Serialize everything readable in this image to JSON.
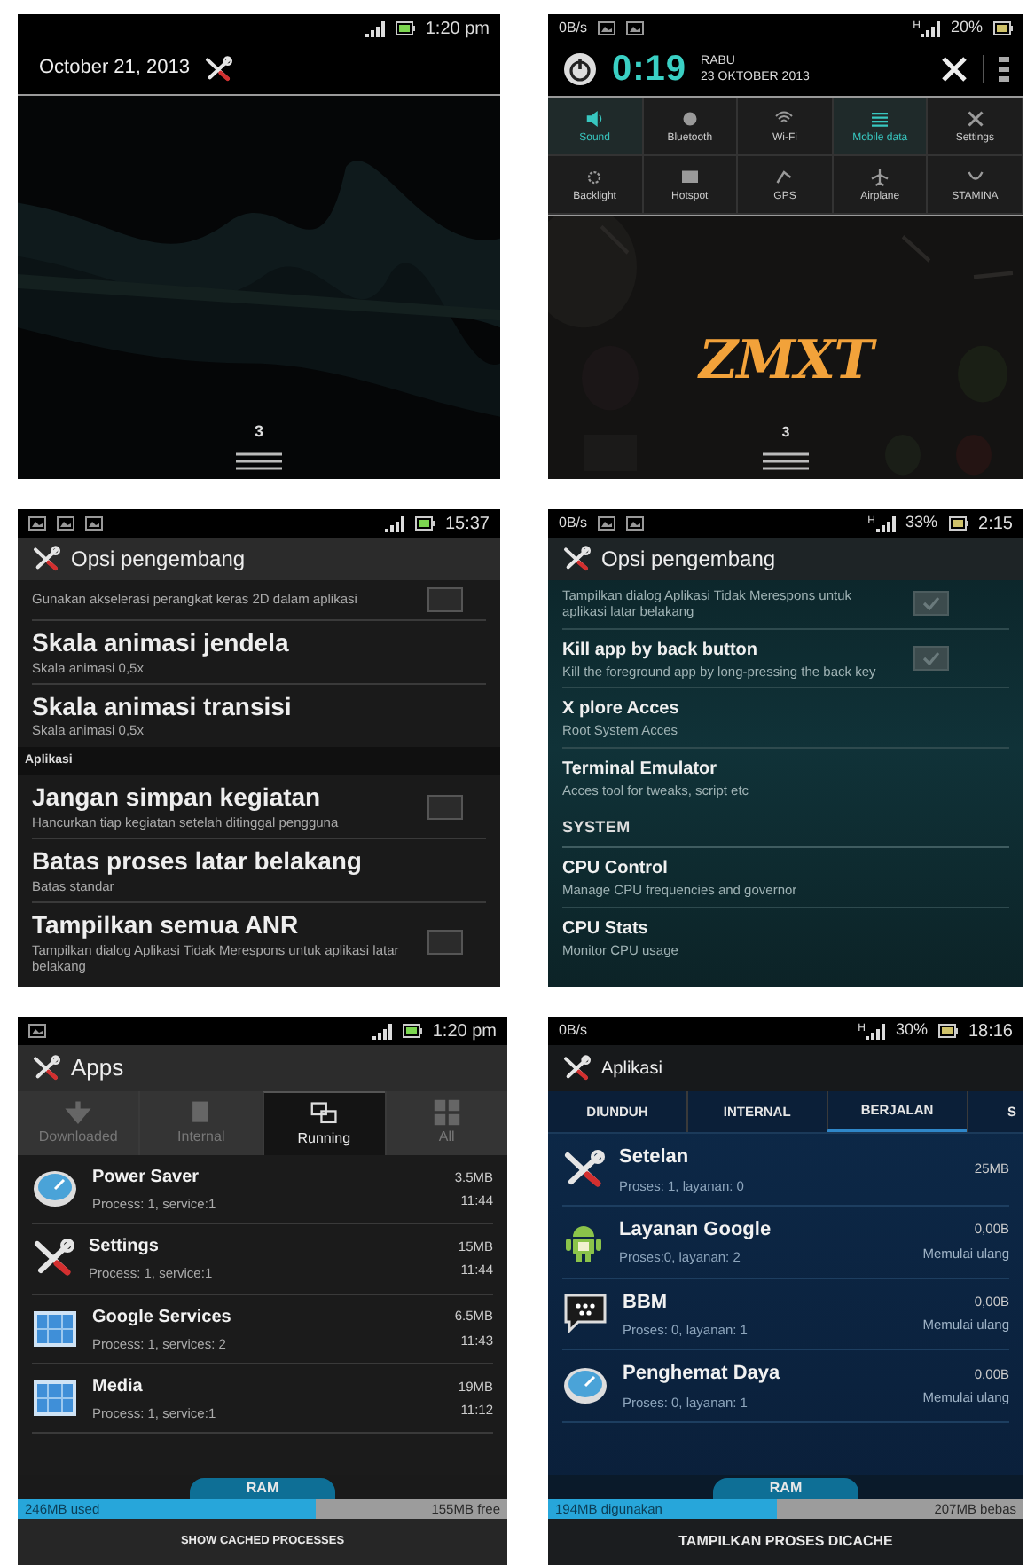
{
  "home_screen": {
    "status_bar": {
      "time": "1:20 pm"
    },
    "date": "October 21, 2013",
    "page_indicator": "3"
  },
  "notification_panel": {
    "status_bar": {
      "speed": "0B/s",
      "network": "H",
      "battery": "20%"
    },
    "clock": "0:19",
    "day": "RABU",
    "date": "23 OKTOBER 2013",
    "toggles": [
      {
        "label": "Sound",
        "on": true
      },
      {
        "label": "Bluetooth",
        "on": false
      },
      {
        "label": "Wi-Fi",
        "on": false
      },
      {
        "label": "Mobile data",
        "on": true
      },
      {
        "label": "Settings",
        "on": false
      },
      {
        "label": "Backlight",
        "on": false
      },
      {
        "label": "Hotspot",
        "on": false
      },
      {
        "label": "GPS",
        "on": false
      },
      {
        "label": "Airplane",
        "on": false
      },
      {
        "label": "STAMINA",
        "on": false
      }
    ],
    "logo": "ZMXT",
    "page_indicator": "3"
  },
  "developer_options": {
    "status_bar": {
      "time": "15:37"
    },
    "title": "Opsi pengembang",
    "items": [
      {
        "kind": "checkbox",
        "summary": "Gunakan akselerasi perangkat keras 2D dalam aplikasi",
        "checked": false
      },
      {
        "kind": "plain",
        "title": "Skala animasi jendela",
        "summary": "Skala animasi 0,5x"
      },
      {
        "kind": "plain",
        "title": "Skala animasi transisi",
        "summary": "Skala animasi 0,5x"
      },
      {
        "kind": "header",
        "title": "Aplikasi"
      },
      {
        "kind": "checkbox",
        "title": "Jangan simpan kegiatan",
        "summary": "Hancurkan tiap kegiatan setelah ditinggal pengguna",
        "checked": false
      },
      {
        "kind": "plain",
        "title": "Batas proses latar belakang",
        "summary": "Batas standar"
      },
      {
        "kind": "checkbox",
        "title": "Tampilkan semua ANR",
        "summary": "Tampilkan dialog Aplikasi Tidak Merespons untuk aplikasi latar belakang",
        "checked": false
      }
    ]
  },
  "developer_options_themed": {
    "status_bar": {
      "speed": "0B/s",
      "network": "H",
      "battery": "33%",
      "time": "2:15"
    },
    "title": "Opsi pengembang",
    "items": [
      {
        "kind": "checkbox",
        "summary": "Tampilkan dialog Aplikasi Tidak Merespons untuk aplikasi latar belakang",
        "checked": true
      },
      {
        "kind": "checkbox",
        "title": "Kill app by back button",
        "summary": "Kill the foreground app by long-pressing the back key",
        "checked": true
      },
      {
        "kind": "plain",
        "title": "X plore Acces",
        "summary": "Root System Acces"
      },
      {
        "kind": "plain",
        "title": "Terminal Emulator",
        "summary": "Acces tool for tweaks, script etc"
      },
      {
        "kind": "header",
        "title": "SYSTEM"
      },
      {
        "kind": "plain",
        "title": "CPU Control",
        "summary": "Manage CPU frequencies and governor"
      },
      {
        "kind": "plain",
        "title": "CPU Stats",
        "summary": "Monitor CPU usage"
      }
    ]
  },
  "apps_running": {
    "status_bar": {
      "time": "1:20 pm"
    },
    "title": "Apps",
    "tabs": [
      {
        "label": "Downloaded",
        "selected": false
      },
      {
        "label": "Internal",
        "selected": false
      },
      {
        "label": "Running",
        "selected": true
      },
      {
        "label": "All",
        "selected": false
      }
    ],
    "apps": [
      {
        "name": "Power Saver",
        "detail": "Process: 1, service:1",
        "size": "3.5MB",
        "time": "11:44"
      },
      {
        "name": "Settings",
        "detail": "Process: 1, service:1",
        "size": "15MB",
        "time": "11:44"
      },
      {
        "name": "Google Services",
        "detail": "Process: 1, services: 2",
        "size": "6.5MB",
        "time": "11:43"
      },
      {
        "name": "Media",
        "detail": "Process: 1, service:1",
        "size": "19MB",
        "time": "11:12"
      }
    ],
    "ram": {
      "label": "RAM",
      "used": "246MB used",
      "free": "155MB free",
      "level": 0.61
    },
    "button": "SHOW CACHED PROCESSES"
  },
  "apps_running_themed": {
    "status_bar": {
      "speed": "0B/s",
      "network": "H",
      "battery": "30%",
      "time": "18:16"
    },
    "title": "Aplikasi",
    "tabs": [
      {
        "label": "DIUNDUH",
        "selected": false
      },
      {
        "label": "INTERNAL",
        "selected": false
      },
      {
        "label": "BERJALAN",
        "selected": true
      },
      {
        "label": "S",
        "selected": false
      }
    ],
    "apps": [
      {
        "name": "Setelan",
        "detail": "Proses: 1, layanan: 0",
        "size": "25MB"
      },
      {
        "name": "Layanan Google",
        "detail": "Proses:0, layanan: 2",
        "size": "0,00B",
        "status": "Memulai ulang"
      },
      {
        "name": "BBM",
        "detail": "Proses: 0, layanan: 1",
        "size": "0,00B",
        "status": "Memulai ulang"
      },
      {
        "name": "Penghemat Daya",
        "detail": "Proses: 0, layanan: 1",
        "size": "0,00B",
        "status": "Memulai ulang"
      }
    ],
    "ram": {
      "label": "RAM",
      "used": "194MB digunakan",
      "free": "207MB bebas",
      "level": 0.48
    },
    "button": "TAMPILKAN PROSES DICACHE"
  }
}
